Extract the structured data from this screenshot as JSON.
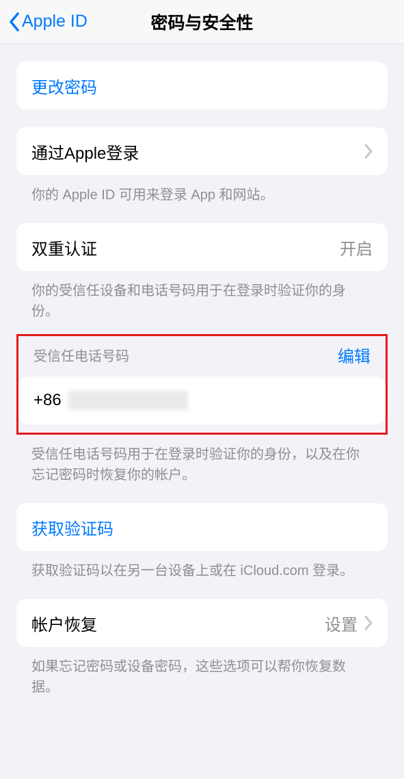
{
  "nav": {
    "back_label": "Apple ID",
    "title": "密码与安全性"
  },
  "change_password": {
    "label": "更改密码"
  },
  "sign_in_with_apple": {
    "label": "通过Apple登录",
    "footer": "你的 Apple ID 可用来登录 App 和网站。"
  },
  "two_factor": {
    "label": "双重认证",
    "value": "开启",
    "footer": "你的受信任设备和电话号码用于在登录时验证你的身份。"
  },
  "trusted_phone": {
    "header": "受信任电话号码",
    "edit": "编辑",
    "prefix": "+86",
    "footer": "受信任电话号码用于在登录时验证你的身份，以及在你忘记密码时恢复你的帐户。"
  },
  "get_code": {
    "label": "获取验证码",
    "footer": "获取验证码以在另一台设备上或在 iCloud.com 登录。"
  },
  "account_recovery": {
    "label": "帐户恢复",
    "value": "设置",
    "footer": "如果忘记密码或设备密码，这些选项可以帮你恢复数据。"
  }
}
